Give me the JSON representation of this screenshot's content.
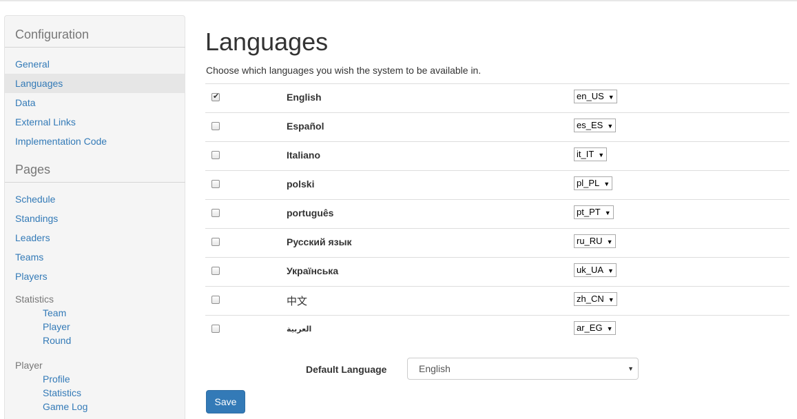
{
  "sidebar": {
    "config_heading": "Configuration",
    "config_items": [
      "General",
      "Languages",
      "Data",
      "External Links",
      "Implementation Code"
    ],
    "pages_heading": "Pages",
    "page_items": [
      "Schedule",
      "Standings",
      "Leaders",
      "Teams",
      "Players"
    ],
    "statistics_label": "Statistics",
    "statistics_items": [
      "Team",
      "Player",
      "Round"
    ],
    "player_label": "Player",
    "player_items": [
      "Profile",
      "Statistics",
      "Game Log"
    ]
  },
  "main": {
    "title": "Languages",
    "description": "Choose which languages you wish the system to be available in.",
    "languages": [
      {
        "name": "English",
        "locale": "en_US",
        "checked": true
      },
      {
        "name": "Español",
        "locale": "es_ES",
        "checked": false
      },
      {
        "name": "Italiano",
        "locale": "it_IT",
        "checked": false
      },
      {
        "name": "polski",
        "locale": "pl_PL",
        "checked": false
      },
      {
        "name": "português",
        "locale": "pt_PT",
        "checked": false
      },
      {
        "name": "Русский язык",
        "locale": "ru_RU",
        "checked": false
      },
      {
        "name": "Українська",
        "locale": "uk_UA",
        "checked": false
      },
      {
        "name": "中文",
        "locale": "zh_CN",
        "checked": false
      },
      {
        "name": "العربية",
        "locale": "ar_EG",
        "checked": false
      }
    ],
    "default_language_label": "Default Language",
    "default_language_value": "English",
    "save_label": "Save"
  },
  "icons": {
    "checkmark": "check-icon",
    "dropdown": "caret-down-icon"
  },
  "colors": {
    "link": "#337ab7",
    "primary_button": "#337ab7",
    "sidebar_bg": "#f5f5f5",
    "active_item_bg": "#e6e6e6"
  }
}
